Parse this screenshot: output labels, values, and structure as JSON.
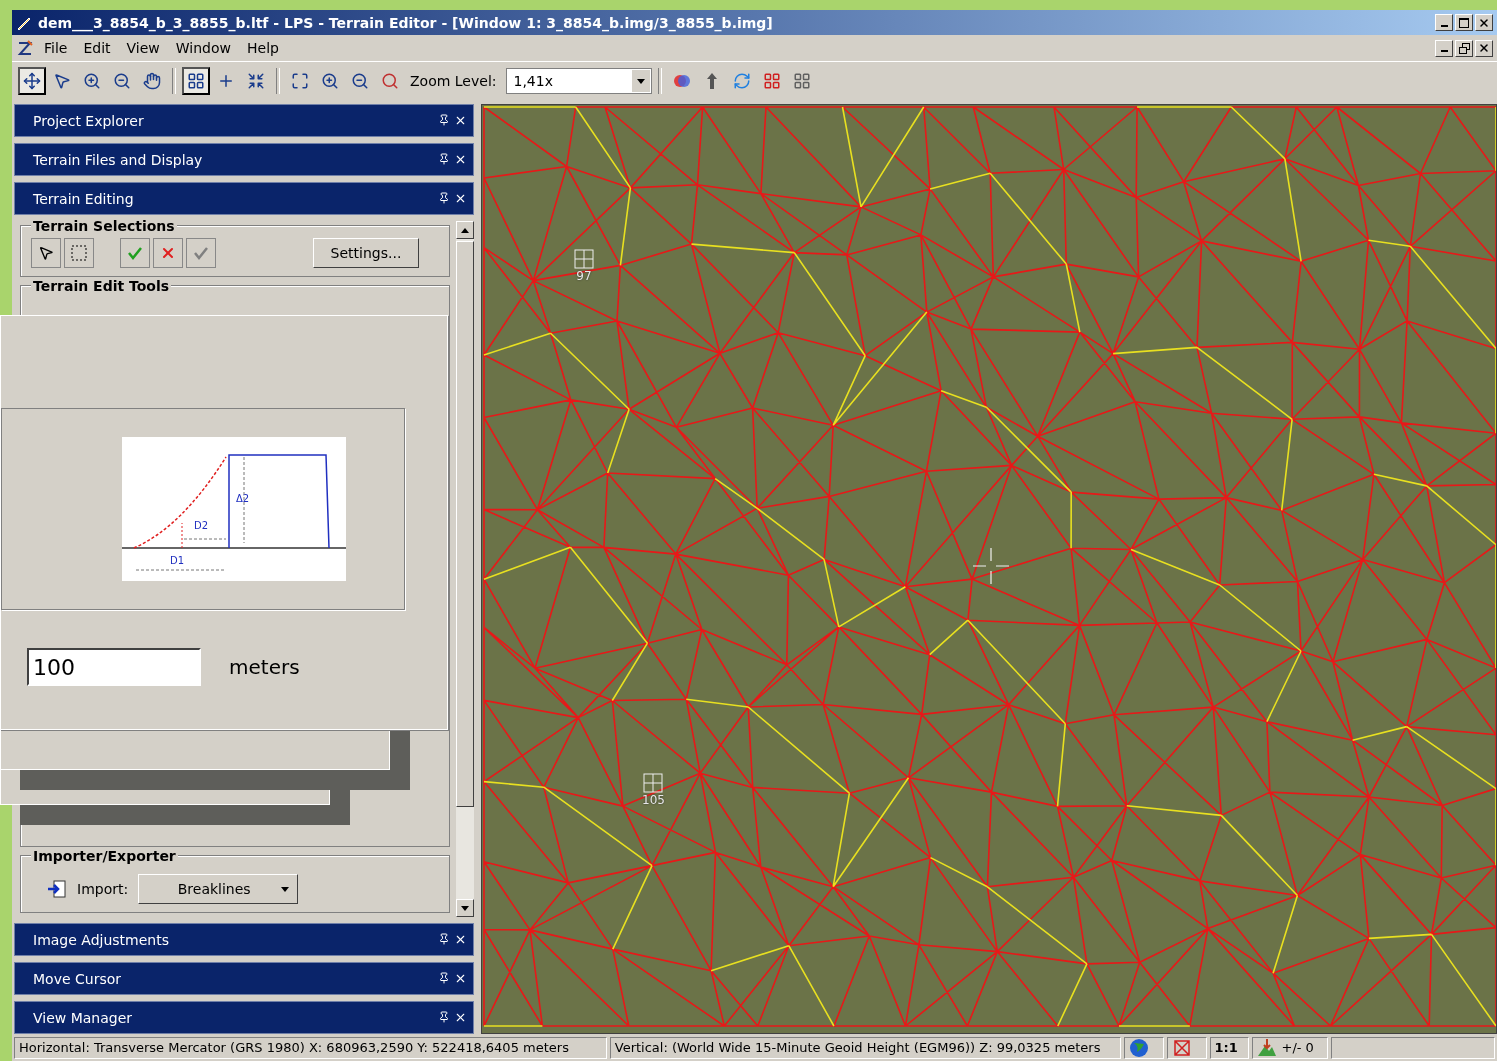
{
  "window": {
    "title": "dem___3_8854_b_3_8855_b.ltf - LPS - Terrain Editor - [Window 1: 3_8854_b.img/3_8855_b.img]"
  },
  "menu": [
    "File",
    "Edit",
    "View",
    "Window",
    "Help"
  ],
  "toolbar": {
    "tools": [
      {
        "selected": true
      },
      {
        "selected": false
      },
      {
        "selected": false
      },
      {
        "selected": false
      },
      {
        "selected": false
      },
      {
        "selected": true
      },
      {
        "selected": false
      },
      {
        "selected": false
      }
    ],
    "zoom_label": "Zoom Level:",
    "zoom_value": "1,41x"
  },
  "panels_top": [
    {
      "title": "Project Explorer"
    },
    {
      "title": "Terrain Files and Display"
    },
    {
      "title": "Terrain Editing"
    }
  ],
  "terrain_editing": {
    "selections_title": "Terrain Selections",
    "settings_button": "Settings...",
    "edit_tools_title": "Terrain Edit Tools",
    "importer_title": "Importer/Exporter",
    "import_label": "Import:",
    "import_value": "Breaklines"
  },
  "panels_bottom": [
    {
      "title": "Image Adjustments"
    },
    {
      "title": "Move Cursor"
    },
    {
      "title": "View Manager"
    }
  ],
  "dialog": {
    "figure_labels": [
      "D2",
      "Δ2",
      "D1"
    ],
    "distance_value": "100",
    "unit": "meters"
  },
  "map": {
    "markers": [
      {
        "label": "97"
      },
      {
        "label": "105"
      }
    ]
  },
  "status_bar": {
    "horizontal": "Horizontal: Transverse Mercator (GRS 1980) X:  680963,2590  Y:  522418,6405 meters",
    "vertical": "Vertical: (World Wide 15-Minute Geoid Height (EGM96)) Z: 99,0325 meters",
    "scale": "1:1",
    "offset": "+/- 0"
  }
}
